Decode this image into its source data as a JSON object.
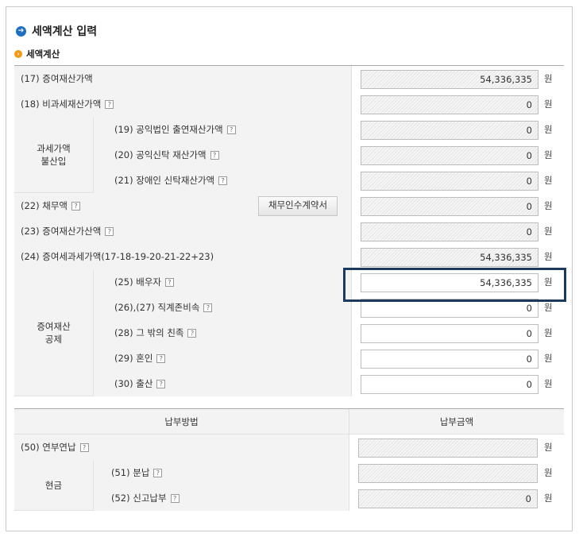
{
  "title": "세액계산 입력",
  "subtitle": "세액계산",
  "unit": "원",
  "help_glyph": "?",
  "tax_table": {
    "group_addback": {
      "line1": "과세가액",
      "line2": "불산입"
    },
    "group_deduction": {
      "line1": "증여재산",
      "line2": "공제"
    },
    "rows": [
      {
        "label": "(17) 증여재산가액",
        "value": "54,336,335",
        "help": false
      },
      {
        "label": "(18) 비과세재산가액",
        "value": "0",
        "help": true
      },
      {
        "label": "(19) 공익법인 출연재산가액",
        "value": "0",
        "help": true
      },
      {
        "label": "(20) 공익신탁 재산가액",
        "value": "0",
        "help": true
      },
      {
        "label": "(21) 장애인 신탁재산가액",
        "value": "0",
        "help": true
      },
      {
        "label": "(22) 채무액",
        "value": "0",
        "help": true,
        "button": "채무인수계약서"
      },
      {
        "label": "(23) 증여재산가산액",
        "value": "0",
        "help": true
      },
      {
        "label": "(24) 증여세과세가액(17-18-19-20-21-22+23)",
        "value": "54,336,335",
        "help": false
      },
      {
        "label": "(25) 배우자",
        "value": "54,336,335",
        "help": true
      },
      {
        "label": "(26),(27) 직계존비속",
        "value": "0",
        "help": true
      },
      {
        "label": "(28) 그 밖의 친족",
        "value": "0",
        "help": true
      },
      {
        "label": "(29) 혼인",
        "value": "0",
        "help": true
      },
      {
        "label": "(30) 출산",
        "value": "0",
        "help": true
      }
    ]
  },
  "payment_table": {
    "header_method": "납부방법",
    "header_amount": "납부금액",
    "group_cash": "현금",
    "rows": [
      {
        "label": "(50) 연부연납",
        "value": ""
      },
      {
        "label": "(51) 분납",
        "value": ""
      },
      {
        "label": "(52) 신고납부",
        "value": "0"
      }
    ]
  }
}
